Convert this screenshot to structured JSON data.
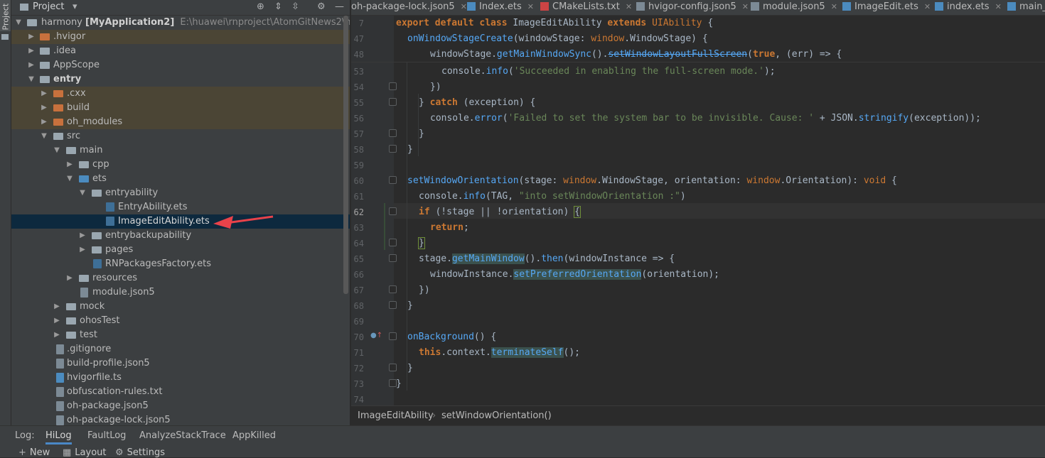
{
  "left_strip": {
    "tab_label": "Project"
  },
  "project_panel": {
    "title": "Project",
    "tree": [
      {
        "label": "harmony",
        "bold": "[MyApplication2]",
        "extra": "E:\\huawei\\rnproject\\AtomGitNews2\\harmony",
        "icon": "folder"
      },
      {
        "label": ".hvigor",
        "icon": "folder-orange",
        "excluded": true
      },
      {
        "label": ".idea",
        "icon": "folder"
      },
      {
        "label": "AppScope",
        "icon": "folder"
      },
      {
        "label": "entry",
        "icon": "folder"
      },
      {
        "label": ".cxx",
        "icon": "folder-orange",
        "excluded": true
      },
      {
        "label": "build",
        "icon": "folder-orange",
        "excluded": true
      },
      {
        "label": "oh_modules",
        "icon": "folder-orange",
        "excluded": true
      },
      {
        "label": "src",
        "icon": "folder"
      },
      {
        "label": "main",
        "icon": "folder"
      },
      {
        "label": "cpp",
        "icon": "folder"
      },
      {
        "label": "ets",
        "icon": "folder-blue"
      },
      {
        "label": "entryability",
        "icon": "folder"
      },
      {
        "label": "EntryAbility.ets",
        "icon": "ets-file"
      },
      {
        "label": "ImageEditAbility.ets",
        "icon": "ets-file",
        "selected": true
      },
      {
        "label": "entrybackupability",
        "icon": "folder"
      },
      {
        "label": "pages",
        "icon": "folder"
      },
      {
        "label": "RNPackagesFactory.ets",
        "icon": "ets-file"
      },
      {
        "label": "resources",
        "icon": "folder"
      },
      {
        "label": "module.json5",
        "icon": "file"
      },
      {
        "label": "mock",
        "icon": "folder"
      },
      {
        "label": "ohosTest",
        "icon": "folder"
      },
      {
        "label": "test",
        "icon": "folder"
      },
      {
        "label": ".gitignore",
        "icon": "file"
      },
      {
        "label": "build-profile.json5",
        "icon": "file"
      },
      {
        "label": "hvigorfile.ts",
        "icon": "file"
      },
      {
        "label": "obfuscation-rules.txt",
        "icon": "file"
      },
      {
        "label": "oh-package.json5",
        "icon": "file"
      },
      {
        "label": "oh-package-lock.json5",
        "icon": "file"
      }
    ]
  },
  "editor_tabs": [
    {
      "label": "oh-package-lock.json5",
      "icon": "json-file-icon"
    },
    {
      "label": "Index.ets",
      "icon": "ets-file-icon"
    },
    {
      "label": "CMakeLists.txt",
      "icon": "cmake-file-icon"
    },
    {
      "label": "hvigor-config.json5",
      "icon": "json-file-icon"
    },
    {
      "label": "module.json5",
      "icon": "json-file-icon"
    },
    {
      "label": "ImageEdit.ets",
      "icon": "ets-file-icon"
    },
    {
      "label": "index.ets",
      "icon": "ets-file-icon"
    },
    {
      "label": "main_",
      "icon": "ets-file-icon"
    }
  ],
  "editor": {
    "line_numbers": [
      "7",
      "47",
      "48",
      "53",
      "54",
      "55",
      "56",
      "57",
      "58",
      "59",
      "60",
      "61",
      "62",
      "63",
      "64",
      "65",
      "66",
      "67",
      "68",
      "69",
      "70",
      "71",
      "72",
      "73",
      "74"
    ],
    "current_line": "62",
    "lines": {
      "l7_a": "export default class ",
      "l7_b": "ImageEditAbility",
      "l7_c": " extends ",
      "l7_d": "UIAbility",
      "l7_e": " {",
      "l47_a": "onWindowStageCreate",
      "l47_b": "(windowStage: ",
      "l47_c": "window",
      "l47_d": ".WindowStage) {",
      "l48_a": "windowStage.",
      "l48_b": "getMainWindowSync",
      "l48_c": "().",
      "l48_d": "setWindowLayoutFullScreen",
      "l48_e": "(",
      "l48_f": "true",
      "l48_g": ", (err) => {",
      "l53_a": "console.",
      "l53_b": "info",
      "l53_c": "(",
      "l53_d": "'Succeeded in enabling the full-screen mode.'",
      "l53_e": ");",
      "l54": "})",
      "l55_a": "} ",
      "l55_b": "catch",
      "l55_c": " (exception) {",
      "l56_a": "console.",
      "l56_b": "error",
      "l56_c": "(",
      "l56_d": "'Failed to set the system bar to be invisible. Cause: '",
      "l56_e": " + JSON.",
      "l56_f": "stringify",
      "l56_g": "(exception));",
      "l57": "}",
      "l58": "}",
      "l60_a": "setWindowOrientation",
      "l60_b": "(stage: ",
      "l60_c": "window",
      "l60_d": ".WindowStage, orientation: ",
      "l60_e": "window",
      "l60_f": ".Orientation): ",
      "l60_g": "void",
      "l60_h": " {",
      "l61_a": "console.",
      "l61_b": "info",
      "l61_c": "(TAG, ",
      "l61_d": "\"into setWindowOrientation :\"",
      "l61_e": ")",
      "l62_a": "if",
      "l62_b": " (!stage || !orientation) ",
      "l62_c": "{",
      "l63_a": "return",
      "l63_b": ";",
      "l64": "}",
      "l65_a": "stage.",
      "l65_b": "getMainWindow",
      "l65_c": "().",
      "l65_d": "then",
      "l65_e": "(windowInstance => {",
      "l66_a": "windowInstance.",
      "l66_b": "setPreferredOrientation",
      "l66_c": "(orientation);",
      "l67": "})",
      "l68": "}",
      "l70_a": "onBackground",
      "l70_b": "() {",
      "l71_a": "this",
      "l71_b": ".context.",
      "l71_c": "terminateSelf",
      "l71_d": "();",
      "l72": "}",
      "l73": "}"
    }
  },
  "breadcrumb": {
    "class_name": "ImageEditAbility",
    "separator": "›",
    "method_name": "setWindowOrientation()"
  },
  "bottom_panel": {
    "log_label": "Log:",
    "tabs": [
      {
        "label": "HiLog",
        "active": true
      },
      {
        "label": "FaultLog"
      },
      {
        "label": "AnalyzeStackTrace"
      },
      {
        "label": "AppKilled"
      }
    ],
    "toolbar": {
      "new_label": "New",
      "layout_label": "Layout",
      "settings_label": "Settings"
    }
  },
  "colors": {
    "accent": "#4a88c7",
    "selection": "#0d293e",
    "excluded": "#4b4535",
    "annotation_arrow": "#e8424a"
  }
}
